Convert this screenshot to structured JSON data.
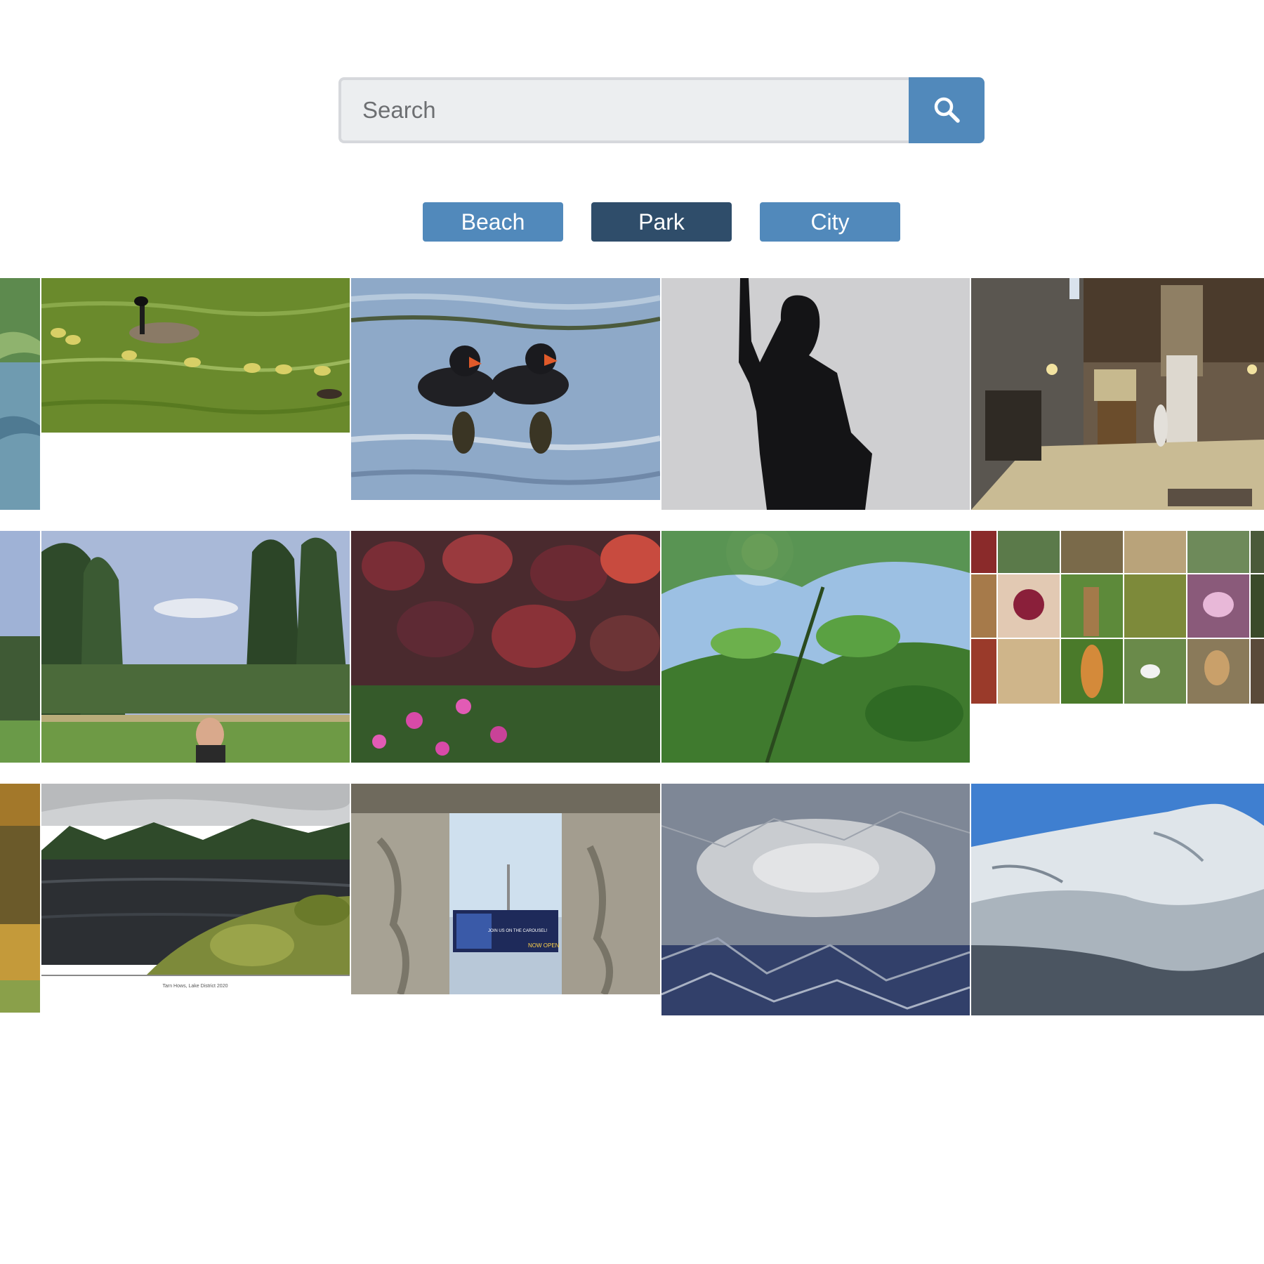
{
  "search": {
    "placeholder": "Search",
    "value": "",
    "button_icon": "search-icon"
  },
  "filters": [
    {
      "label": "Beach",
      "active": false
    },
    {
      "label": "Park",
      "active": true
    },
    {
      "label": "City",
      "active": false
    }
  ],
  "colors": {
    "accent": "#5189bb",
    "accent_active": "#2f4d6a",
    "input_bg": "#eceef0"
  },
  "gallery": {
    "photos": [
      {
        "subject": "geese-on-pond"
      },
      {
        "subject": "coot-chicks-swimming"
      },
      {
        "subject": "statue-silhouette"
      },
      {
        "subject": "stone-hall-interior"
      },
      {
        "subject": "poplar-trees-park"
      },
      {
        "subject": "red-leaves-pink-flowers"
      },
      {
        "subject": "sunlit-green-leaves"
      },
      {
        "subject": "park-collage"
      },
      {
        "subject": "tarn-lake-landscape"
      },
      {
        "subject": "stone-window-view"
      },
      {
        "subject": "frozen-ice-surface"
      },
      {
        "subject": "snowy-mountain"
      }
    ],
    "captions": {
      "tarn": "Tarn Hows, Lake District 2020",
      "window_banner": "JOIN US ON THE CAROUSEL!",
      "window_sign": "NOW OPEN"
    }
  }
}
